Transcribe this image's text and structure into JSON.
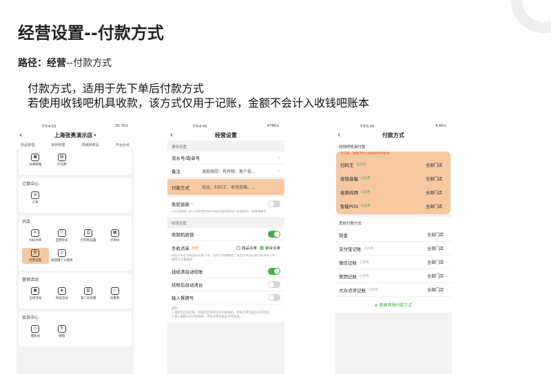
{
  "slide": {
    "title": "经营设置--付款方式",
    "path_label": "路径：",
    "path_bold": "经营",
    "path_rest": "--付款方式",
    "desc_line1": "付款方式，适用于先下单后付款方式",
    "desc_line2": "若使用收钱吧机具收款，该方式仅用于记账，金额不会计入收钱吧账本"
  },
  "phone1": {
    "status_time": "下午4:53",
    "status_info": "20.7K/s",
    "store_name": "上海张勇演示店",
    "tabs": [
      "商品管理",
      "库存管理",
      "热销排商品",
      "开台必点"
    ],
    "top_items": [
      {
        "label": "沽清管理",
        "icon": "sold-out-icon"
      },
      {
        "label": "打包费",
        "icon": "package-icon"
      }
    ],
    "order_center": {
      "title": "订单中心",
      "items": [
        {
          "label": "订单",
          "icon": "order-icon"
        }
      ]
    },
    "open_store": {
      "title": "开店",
      "items": [
        {
          "label": "扫码点单",
          "icon": "scan-order-icon"
        },
        {
          "label": "自营外卖",
          "icon": "delivery-icon"
        },
        {
          "label": "打印机设置",
          "icon": "printer-icon"
        },
        {
          "label": "点单码",
          "icon": "order-code-icon"
        },
        {
          "label": "经营设置",
          "icon": "business-settings-icon"
        },
        {
          "label": "美团饿了么授权",
          "icon": "authorize-icon"
        }
      ]
    },
    "marketing": {
      "title": "营销活动",
      "items": [
        {
          "label": "全场活动",
          "icon": "store-promo-icon"
        },
        {
          "label": "单品活动",
          "icon": "item-promo-icon"
        },
        {
          "label": "第二份优惠",
          "icon": "second-discount-icon"
        },
        {
          "label": "优惠券",
          "icon": "coupon-icon"
        }
      ]
    },
    "member": {
      "title": "会员中心",
      "items": [
        {
          "label": "储会员",
          "icon": "member-icon"
        },
        {
          "label": "储值",
          "icon": "stored-value-icon"
        }
      ]
    }
  },
  "phone2": {
    "status_time": "下午4:49",
    "status_info": "478K/s",
    "title": "经营设置",
    "general_label": "通用设置",
    "rows": [
      {
        "label": "流水号/取单号",
        "value": ""
      },
      {
        "label": "备注",
        "value": "退款原因：有异物、客户投…"
      },
      {
        "label": "付款方式",
        "value": "现金、扫码王、收钱音箱、…"
      }
    ],
    "free_refund": {
      "label": "免密退款",
      "note": "开启后管理门店订单退款时将不再验证收钱吧商户管理密码，请谨慎操作"
    },
    "cashier_label": "收银设置",
    "cashier_row": "收银机收银",
    "phone_order": {
      "label": "手机点单",
      "tag": "新增",
      "opt1": "商品点单",
      "opt2": "桌台点单",
      "note": "商品点单是以商品的形式下单，适用于快餐模式；桌台点单是以桌台的形式下单，适用于正餐模式"
    },
    "toggles": [
      {
        "label": "钱结清自动结账",
        "on": true
      },
      {
        "label": "结账后自动清台",
        "on": false
      },
      {
        "label": "输入餐牌号",
        "on": false
      }
    ],
    "explain": [
      "说明：",
      "1.钱结清自动结账、结账后自动清台仅对收银机、手机点单的桌台点单生效；",
      "2.输入餐牌号仅对收银机、手机点单的商品点单生效。"
    ]
  },
  "phone3": {
    "status_time": "下午5:04",
    "status_info": "9.6K/s",
    "title": "付款方式",
    "device_label": "收钱吧机具付款",
    "device_warn": "仅记账，金额不计入收钱吧APP账本",
    "device_methods": [
      {
        "name": "扫码王",
        "status": "已启用",
        "scope": "全部门店"
      },
      {
        "name": "收钱音箱",
        "status": "已启用",
        "scope": "全部门店"
      },
      {
        "name": "收款码牌",
        "status": "已启用",
        "scope": "全部门店"
      },
      {
        "name": "智能POS",
        "status": "已启用",
        "scope": "全部门店"
      }
    ],
    "other_label": "其他付款方式",
    "other_methods": [
      {
        "name": "现金",
        "status": "已启用",
        "scope": "全部门店",
        "enabled": true
      },
      {
        "name": "支付宝记账",
        "status": "已停用",
        "scope": "全部门店",
        "enabled": false
      },
      {
        "name": "微信记账",
        "status": "已停用",
        "scope": "全部门店",
        "enabled": false
      },
      {
        "name": "美团记账",
        "status": "已停用",
        "scope": "全部门店",
        "enabled": false
      },
      {
        "name": "大众点评记账",
        "status": "已停用",
        "scope": "全部门店",
        "enabled": false
      }
    ],
    "add_label": "新建其他付款方式"
  },
  "colors": {
    "accent_green": "#3fae48",
    "highlight_orange": "#f6c9a3",
    "warn_red": "#e4572e"
  }
}
